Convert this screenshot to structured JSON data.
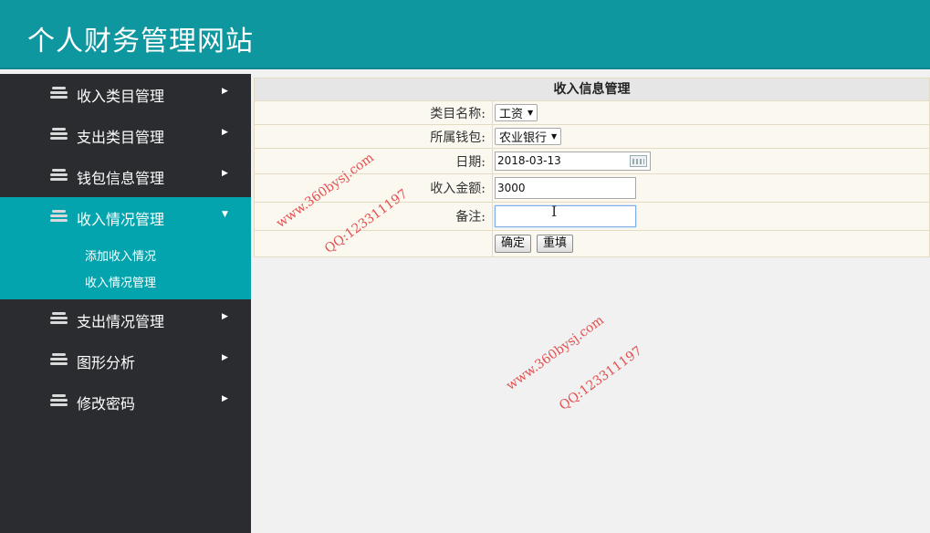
{
  "header": {
    "title": "个人财务管理网站"
  },
  "sidebar": {
    "items": [
      {
        "label": "收入类目管理",
        "arrow": "▶"
      },
      {
        "label": "支出类目管理",
        "arrow": "▶"
      },
      {
        "label": "钱包信息管理",
        "arrow": "▶"
      },
      {
        "label": "收入情况管理",
        "arrow": "▼",
        "active": true,
        "children": [
          {
            "label": "添加收入情况"
          },
          {
            "label": "收入情况管理"
          }
        ]
      },
      {
        "label": "支出情况管理",
        "arrow": "▶"
      },
      {
        "label": "图形分析",
        "arrow": "▶"
      },
      {
        "label": "修改密码",
        "arrow": "▶"
      }
    ],
    "icon": "list-icon"
  },
  "form": {
    "title": "收入信息管理",
    "category": {
      "label": "类目名称:",
      "value": "工资"
    },
    "wallet": {
      "label": "所属钱包:",
      "value": "农业银行"
    },
    "date": {
      "label": "日期:",
      "value": "2018-03-13"
    },
    "amount": {
      "label": "收入金额:",
      "value": "3000"
    },
    "note": {
      "label": "备注:",
      "value": ""
    },
    "submit_label": "确定",
    "reset_label": "重填"
  },
  "watermarks": {
    "site": "www.360bysj.com",
    "qq": "QQ:123311197"
  },
  "colors": {
    "header": "#0f97a0",
    "sidebar": "#2b2c30",
    "active": "#03a4ad",
    "watermark": "#e55050"
  }
}
